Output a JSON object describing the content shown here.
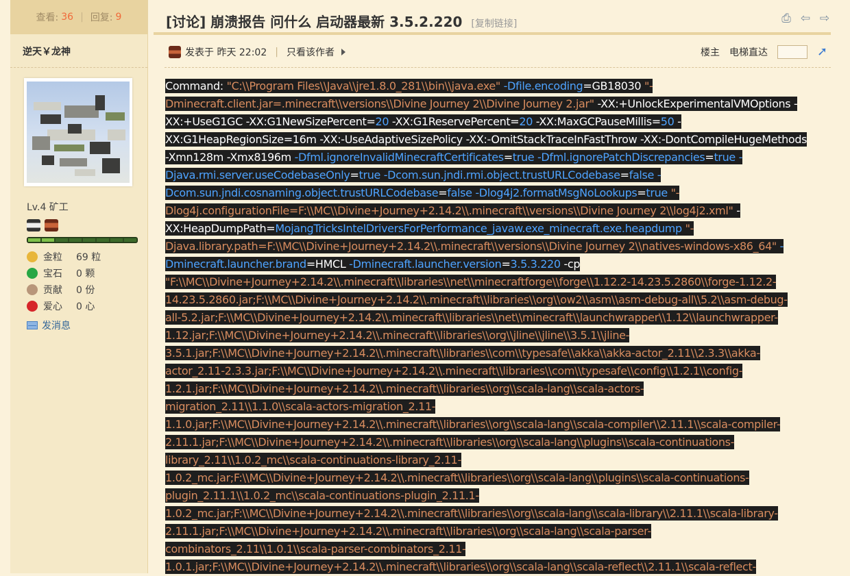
{
  "stats": {
    "views_label": "查看:",
    "views": "36",
    "replies_label": "回复:",
    "replies": "9"
  },
  "author": {
    "name": "逆天￥龙神",
    "level": "Lv.4 矿工",
    "attrs": [
      {
        "icon": "gold-nugget-icon",
        "label": "金粒",
        "value": "69 粒",
        "color": "#e8b63a"
      },
      {
        "icon": "emerald-icon",
        "label": "宝石",
        "value": "0 颗",
        "color": "#28a745"
      },
      {
        "icon": "contribution-icon",
        "label": "贡献",
        "value": "0 份",
        "color": "#b8967a"
      },
      {
        "icon": "apple-icon",
        "label": "爱心",
        "value": "0 心",
        "color": "#d6262a"
      }
    ],
    "send_message": "发消息"
  },
  "thread": {
    "title": "[讨论] 崩溃报告 问什么 启动器最新 3.5.2.220",
    "copy_link": "[复制链接]"
  },
  "post_meta": {
    "posted_at": "发表于 昨天 22:02",
    "only_author": "只看该作者",
    "floor": "楼主",
    "elevator": "电梯直达"
  },
  "command_lines": [
    [
      [
        "w",
        "Command: "
      ],
      [
        "o",
        "\"C:\\\\Program Files\\\\Java\\\\jre1.8.0_281\\\\bin\\\\java.exe\" "
      ],
      [
        "b",
        "-Dfile.encoding"
      ],
      [
        "w",
        "="
      ],
      [
        "w",
        "GB18030 "
      ],
      [
        "o",
        "\"-"
      ]
    ],
    [
      [
        "o",
        "Dminecraft.client.jar=.minecraft\\\\versions\\\\Divine Journey 2\\\\Divine Journey 2.jar\" "
      ],
      [
        "w",
        "-XX:+UnlockExperimentalVMOptions -"
      ]
    ],
    [
      [
        "w",
        "XX:+UseG1GC -XX:G1NewSizePercent="
      ],
      [
        "b",
        "20"
      ],
      [
        "w",
        " -XX:G1ReservePercent="
      ],
      [
        "b",
        "20"
      ],
      [
        "w",
        " -XX:MaxGCPauseMillis="
      ],
      [
        "b",
        "50"
      ],
      [
        "w",
        " -"
      ]
    ],
    [
      [
        "w",
        "XX:G1HeapRegionSize=16m -XX:-UseAdaptiveSizePolicy -XX:-OmitStackTraceInFastThrow -XX:-DontCompileHugeMethods"
      ]
    ],
    [
      [
        "w",
        "-Xmn128m -Xmx8196m "
      ],
      [
        "b",
        "-Dfml.ignoreInvalidMinecraftCertificates"
      ],
      [
        "w",
        "="
      ],
      [
        "b",
        "true"
      ],
      [
        "w",
        " "
      ],
      [
        "b",
        "-Dfml.ignorePatchDiscrepancies"
      ],
      [
        "w",
        "="
      ],
      [
        "b",
        "true -"
      ]
    ],
    [
      [
        "b",
        "Djava.rmi.server.useCodebaseOnly"
      ],
      [
        "w",
        "="
      ],
      [
        "b",
        "true"
      ],
      [
        "w",
        " "
      ],
      [
        "b",
        "-Dcom.sun.jndi.rmi.object.trustURLCodebase"
      ],
      [
        "w",
        "="
      ],
      [
        "b",
        "false -"
      ]
    ],
    [
      [
        "b",
        "Dcom.sun.jndi.cosnaming.object.trustURLCodebase"
      ],
      [
        "w",
        "="
      ],
      [
        "b",
        "false"
      ],
      [
        "w",
        " "
      ],
      [
        "b",
        "-Dlog4j2.formatMsgNoLookups"
      ],
      [
        "w",
        "="
      ],
      [
        "b",
        "true"
      ],
      [
        "w",
        " "
      ],
      [
        "o",
        "\"-"
      ]
    ],
    [
      [
        "o",
        "Dlog4j.configurationFile=F:\\\\MC\\\\Divine+Journey+2.14.2\\\\.minecraft\\\\versions\\\\Divine Journey 2\\\\log4j2.xml\" "
      ],
      [
        "w",
        "-"
      ]
    ],
    [
      [
        "w",
        "XX:HeapDumpPath="
      ],
      [
        "b",
        "MojangTricksIntelDriversForPerformance_javaw.exe_minecraft.exe.heapdump"
      ],
      [
        "w",
        " "
      ],
      [
        "o",
        "\"-"
      ]
    ],
    [
      [
        "o",
        "Djava.library.path=F:\\\\MC\\\\Divine+Journey+2.14.2\\\\.minecraft\\\\versions\\\\Divine Journey 2\\\\natives-windows-x86_64\" "
      ],
      [
        "b",
        "-"
      ]
    ],
    [
      [
        "b",
        "Dminecraft.launcher.brand"
      ],
      [
        "w",
        "="
      ],
      [
        "w",
        "HMCL "
      ],
      [
        "b",
        "-Dminecraft.launcher.version"
      ],
      [
        "w",
        "="
      ],
      [
        "b",
        "3.5.3.220"
      ],
      [
        "w",
        " -cp"
      ]
    ],
    [
      [
        "o",
        "\"F:\\\\MC\\\\Divine+Journey+2.14.2\\\\.minecraft\\\\libraries\\\\net\\\\minecraftforge\\\\forge\\\\1.12.2-14.23.5.2860\\\\forge-1.12.2-"
      ]
    ],
    [
      [
        "o",
        "14.23.5.2860.jar;F:\\\\MC\\\\Divine+Journey+2.14.2\\\\.minecraft\\\\libraries\\\\org\\\\ow2\\\\asm\\\\asm-debug-all\\\\5.2\\\\asm-debug-"
      ]
    ],
    [
      [
        "o",
        "all-5.2.jar;F:\\\\MC\\\\Divine+Journey+2.14.2\\\\.minecraft\\\\libraries\\\\net\\\\minecraft\\\\launchwrapper\\\\1.12\\\\launchwrapper-"
      ]
    ],
    [
      [
        "o",
        "1.12.jar;F:\\\\MC\\\\Divine+Journey+2.14.2\\\\.minecraft\\\\libraries\\\\org\\\\jline\\\\jline\\\\3.5.1\\\\jline-"
      ]
    ],
    [
      [
        "o",
        "3.5.1.jar;F:\\\\MC\\\\Divine+Journey+2.14.2\\\\.minecraft\\\\libraries\\\\com\\\\typesafe\\\\akka\\\\akka-actor_2.11\\\\2.3.3\\\\akka-"
      ]
    ],
    [
      [
        "o",
        "actor_2.11-2.3.3.jar;F:\\\\MC\\\\Divine+Journey+2.14.2\\\\.minecraft\\\\libraries\\\\com\\\\typesafe\\\\config\\\\1.2.1\\\\config-"
      ]
    ],
    [
      [
        "o",
        "1.2.1.jar;F:\\\\MC\\\\Divine+Journey+2.14.2\\\\.minecraft\\\\libraries\\\\org\\\\scala-lang\\\\scala-actors-"
      ]
    ],
    [
      [
        "o",
        "migration_2.11\\\\1.1.0\\\\scala-actors-migration_2.11-"
      ]
    ],
    [
      [
        "o",
        "1.1.0.jar;F:\\\\MC\\\\Divine+Journey+2.14.2\\\\.minecraft\\\\libraries\\\\org\\\\scala-lang\\\\scala-compiler\\\\2.11.1\\\\scala-compiler-"
      ]
    ],
    [
      [
        "o",
        "2.11.1.jar;F:\\\\MC\\\\Divine+Journey+2.14.2\\\\.minecraft\\\\libraries\\\\org\\\\scala-lang\\\\plugins\\\\scala-continuations-"
      ]
    ],
    [
      [
        "o",
        "library_2.11\\\\1.0.2_mc\\\\scala-continuations-library_2.11-"
      ]
    ],
    [
      [
        "o",
        "1.0.2_mc.jar;F:\\\\MC\\\\Divine+Journey+2.14.2\\\\.minecraft\\\\libraries\\\\org\\\\scala-lang\\\\plugins\\\\scala-continuations-"
      ]
    ],
    [
      [
        "o",
        "plugin_2.11.1\\\\1.0.2_mc\\\\scala-continuations-plugin_2.11.1-"
      ]
    ],
    [
      [
        "o",
        "1.0.2_mc.jar;F:\\\\MC\\\\Divine+Journey+2.14.2\\\\.minecraft\\\\libraries\\\\org\\\\scala-lang\\\\scala-library\\\\2.11.1\\\\scala-library-"
      ]
    ],
    [
      [
        "o",
        "2.11.1.jar;F:\\\\MC\\\\Divine+Journey+2.14.2\\\\.minecraft\\\\libraries\\\\org\\\\scala-lang\\\\scala-parser-"
      ]
    ],
    [
      [
        "o",
        "combinators_2.11\\\\1.0.1\\\\scala-parser-combinators_2.11-"
      ]
    ],
    [
      [
        "o",
        "1.0.1.jar;F:\\\\MC\\\\Divine+Journey+2.14.2\\\\.minecraft\\\\libraries\\\\org\\\\scala-lang\\\\scala-reflect\\\\2.11.1\\\\scala-reflect-"
      ]
    ]
  ]
}
